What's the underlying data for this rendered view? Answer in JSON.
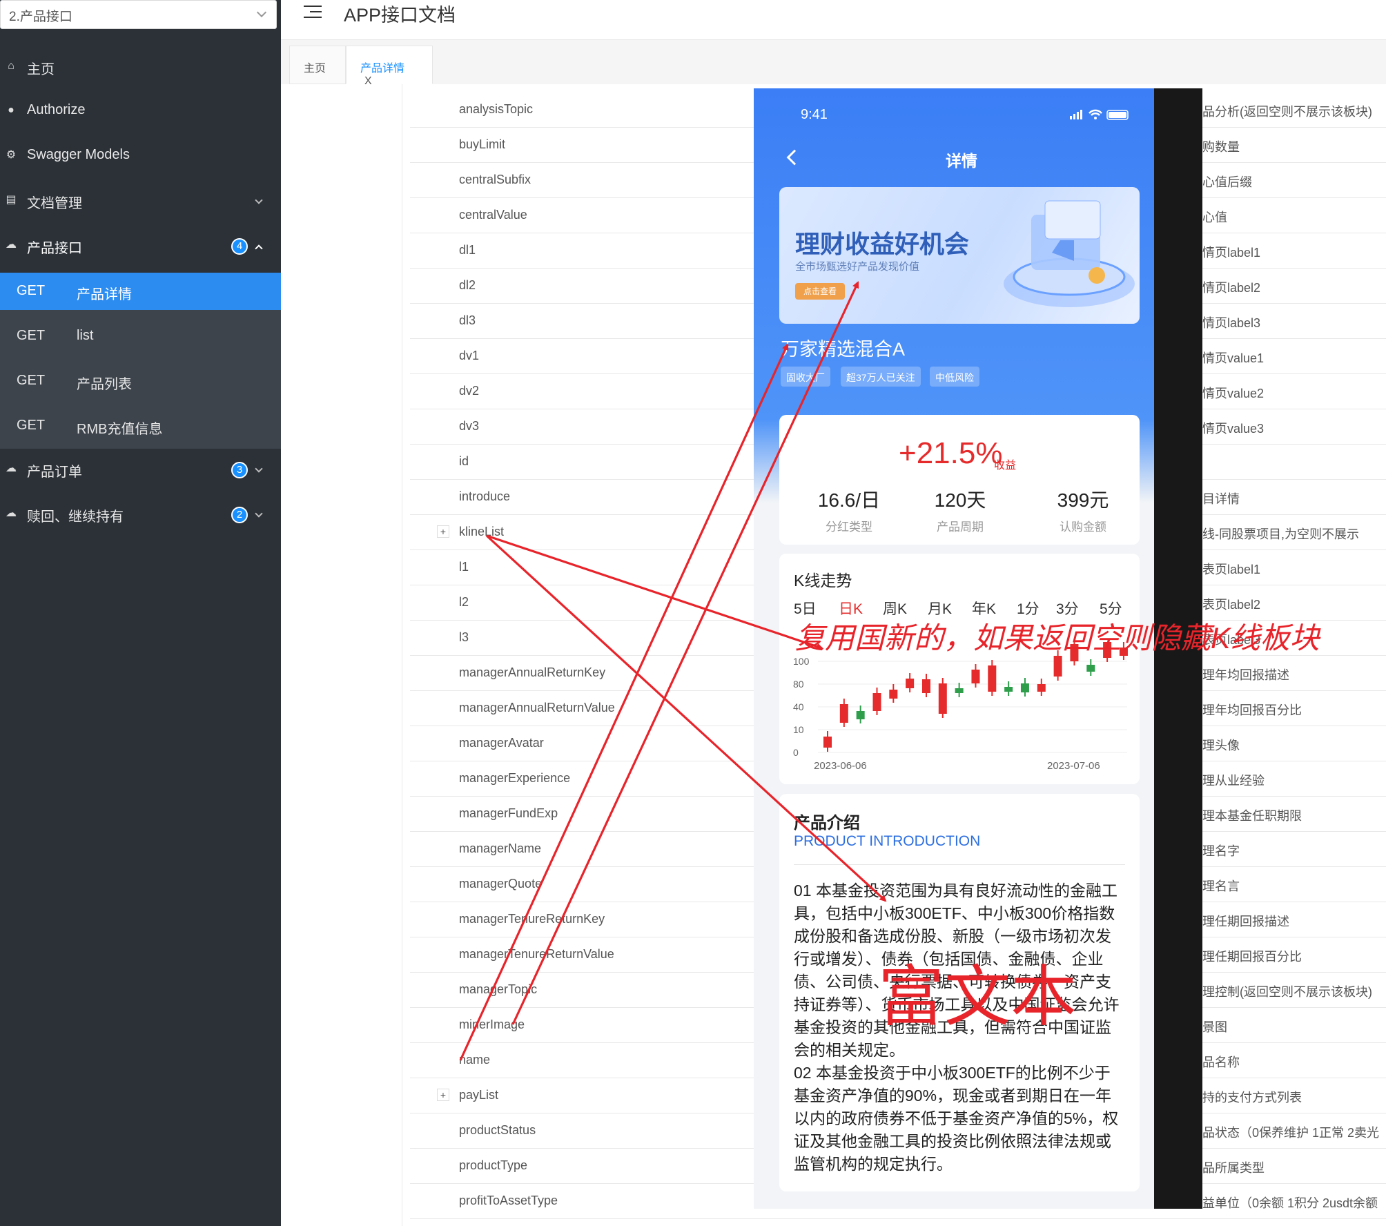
{
  "sidebar": {
    "select_value": "2.产品接口",
    "items": [
      {
        "label": "主页"
      },
      {
        "label": "Authorize"
      },
      {
        "label": "Swagger Models"
      },
      {
        "label": "文档管理"
      },
      {
        "label": "产品接口",
        "badge": "4"
      },
      {
        "label": "产品订单",
        "badge": "3"
      },
      {
        "label": "赎回、继续持有",
        "badge": "2"
      }
    ],
    "sub_items": [
      {
        "method": "GET",
        "label": "产品详情"
      },
      {
        "method": "GET",
        "label": "list"
      },
      {
        "method": "GET",
        "label": "产品列表"
      },
      {
        "method": "GET",
        "label": "RMB充值信息"
      }
    ]
  },
  "header": {
    "title": "APP接口文档"
  },
  "tabs": [
    {
      "label": "主页"
    },
    {
      "label": "产品详情",
      "close": "X"
    }
  ],
  "rows": [
    {
      "field": "analysisTopic",
      "desc": "品分析(返回空则不展示该板块)"
    },
    {
      "field": "buyLimit",
      "desc": "购数量"
    },
    {
      "field": "centralSubfix",
      "desc": "心值后缀"
    },
    {
      "field": "centralValue",
      "desc": "心值"
    },
    {
      "field": "dl1",
      "desc": "情页label1"
    },
    {
      "field": "dl2",
      "desc": "情页label2"
    },
    {
      "field": "dl3",
      "desc": "情页label3"
    },
    {
      "field": "dv1",
      "desc": "情页value1"
    },
    {
      "field": "dv2",
      "desc": "情页value2"
    },
    {
      "field": "dv3",
      "desc": "情页value3"
    },
    {
      "field": "id",
      "desc": ""
    },
    {
      "field": "introduce",
      "desc": "目详情"
    },
    {
      "field": "klineList",
      "desc": "线-同股票项目,为空则不展示",
      "expand": "+"
    },
    {
      "field": "l1",
      "desc": "表页label1"
    },
    {
      "field": "l2",
      "desc": "表页label2"
    },
    {
      "field": "l3",
      "desc": "表页label3"
    },
    {
      "field": "managerAnnualReturnKey",
      "desc": "理年均回报描述"
    },
    {
      "field": "managerAnnualReturnValue",
      "desc": "理年均回报百分比"
    },
    {
      "field": "managerAvatar",
      "desc": "理头像"
    },
    {
      "field": "managerExperience",
      "desc": "理从业经验"
    },
    {
      "field": "managerFundExp",
      "desc": "理本基金任职期限"
    },
    {
      "field": "managerName",
      "desc": "理名字"
    },
    {
      "field": "managerQuote",
      "desc": "理名言"
    },
    {
      "field": "managerTenureReturnKey",
      "desc": "理任期回报描述"
    },
    {
      "field": "managerTenureReturnValue",
      "desc": "理任期回报百分比"
    },
    {
      "field": "managerTopic",
      "desc": "理控制(返回空则不展示该板块)"
    },
    {
      "field": "minerImage",
      "desc": "景图"
    },
    {
      "field": "name",
      "desc": "品名称"
    },
    {
      "field": "payList",
      "desc": "持的支付方式列表",
      "expand": "+"
    },
    {
      "field": "productStatus",
      "desc": "品状态（0保养维护 1正常 2卖光"
    },
    {
      "field": "productType",
      "desc": "品所属类型"
    },
    {
      "field": "profitToAssetType",
      "desc": "益单位（0余额 1积分 2usdt余额"
    }
  ],
  "phone": {
    "time": "9:41",
    "title": "详情",
    "banner_title": "理财收益好机会",
    "banner_sub": "全市场甄选好产品发现价值",
    "banner_btn": "点击查看",
    "fund_name": "万家精选混合A",
    "tags": [
      "固收大厂",
      "超37万人已关注",
      "中低风险"
    ],
    "return_value": "+21.5%",
    "return_suffix": "收益",
    "stats": [
      {
        "value": "16.6/日",
        "label": "分红类型"
      },
      {
        "value": "120天",
        "label": "产品周期"
      },
      {
        "value": "399元",
        "label": "认购金额"
      }
    ],
    "kline_title": "K线走势",
    "kline_tabs": [
      "5日",
      "日K",
      "周K",
      "月K",
      "年K",
      "1分",
      "3分",
      "5分"
    ],
    "kline_active": "日K",
    "intro_title": "产品介绍",
    "intro_en": "PRODUCT INTRODUCTION",
    "intro_p1": "01 本基金投资范围为具有良好流动性的金融工具，包括中小板300ETF、中小板300价格指数成份股和备选成份股、新股（一级市场初次发行或增发）、债券（包括国债、金融债、企业债、公司债、央行票据、可转换债券、资产支持证券等）、货币市场工具以及中国证监会允许基金投资的其他金融工具，但需符合中国证监会的相关规定。",
    "intro_p2": "02 本基金投资于中小板300ETF的比例不少于基金资产净值的90%，现金或者到期日在一年以内的政府债券不低于基金资产净值的5%，权证及其他金融工具的投资比例依照法律法规或监管机构的规定执行。"
  },
  "annotations": {
    "kline_note": "复用国新的，如果返回空则隐藏K线板块",
    "rich_text": "富文本"
  },
  "chart_data": {
    "type": "candlestick",
    "x_start": "2023-06-06",
    "x_end": "2023-07-06",
    "y_ticks": [
      "0",
      "10",
      "40",
      "80",
      "100"
    ],
    "candles": [
      {
        "open": 7,
        "close": 23,
        "color": "red"
      },
      {
        "open": 43,
        "close": 70,
        "color": "red"
      },
      {
        "open": 60,
        "close": 48,
        "color": "green"
      },
      {
        "open": 60,
        "close": 86,
        "color": "red"
      },
      {
        "open": 78,
        "close": 91,
        "color": "red"
      },
      {
        "open": 93,
        "close": 107,
        "color": "red"
      },
      {
        "open": 86,
        "close": 106,
        "color": "red"
      },
      {
        "open": 56,
        "close": 100,
        "color": "red"
      },
      {
        "open": 86,
        "close": 93,
        "color": "green"
      },
      {
        "open": 100,
        "close": 120,
        "color": "red"
      },
      {
        "open": 88,
        "close": 126,
        "color": "red"
      },
      {
        "open": 88,
        "close": 95,
        "color": "green"
      },
      {
        "open": 87,
        "close": 100,
        "color": "green"
      },
      {
        "open": 88,
        "close": 99,
        "color": "red"
      },
      {
        "open": 110,
        "close": 140,
        "color": "red"
      },
      {
        "open": 132,
        "close": 157,
        "color": "red"
      },
      {
        "open": 117,
        "close": 127,
        "color": "green"
      },
      {
        "open": 137,
        "close": 160,
        "color": "red"
      },
      {
        "open": 140,
        "close": 152,
        "color": "red"
      }
    ],
    "colors": {
      "up": "#e52b2b",
      "down": "#2e9e4b"
    }
  }
}
